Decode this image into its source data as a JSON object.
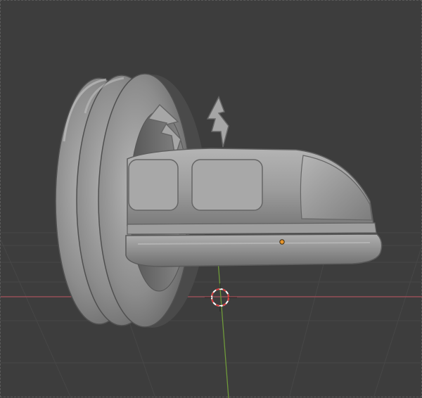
{
  "viewport": {
    "background": "#3d3d3d",
    "grid_color": "#474747",
    "x_axis_color": "#a8525c",
    "y_axis_color": "#6f9a3a",
    "mesh_color": "#9a9a9a",
    "origin_color": "#e8962c",
    "cursor_colors": [
      "#ffffff",
      "#d83a3a"
    ]
  },
  "scene": {
    "object": "hover-pod-with-ring-mesh",
    "icons": [
      "3d-cursor-icon",
      "object-origin-icon"
    ]
  }
}
